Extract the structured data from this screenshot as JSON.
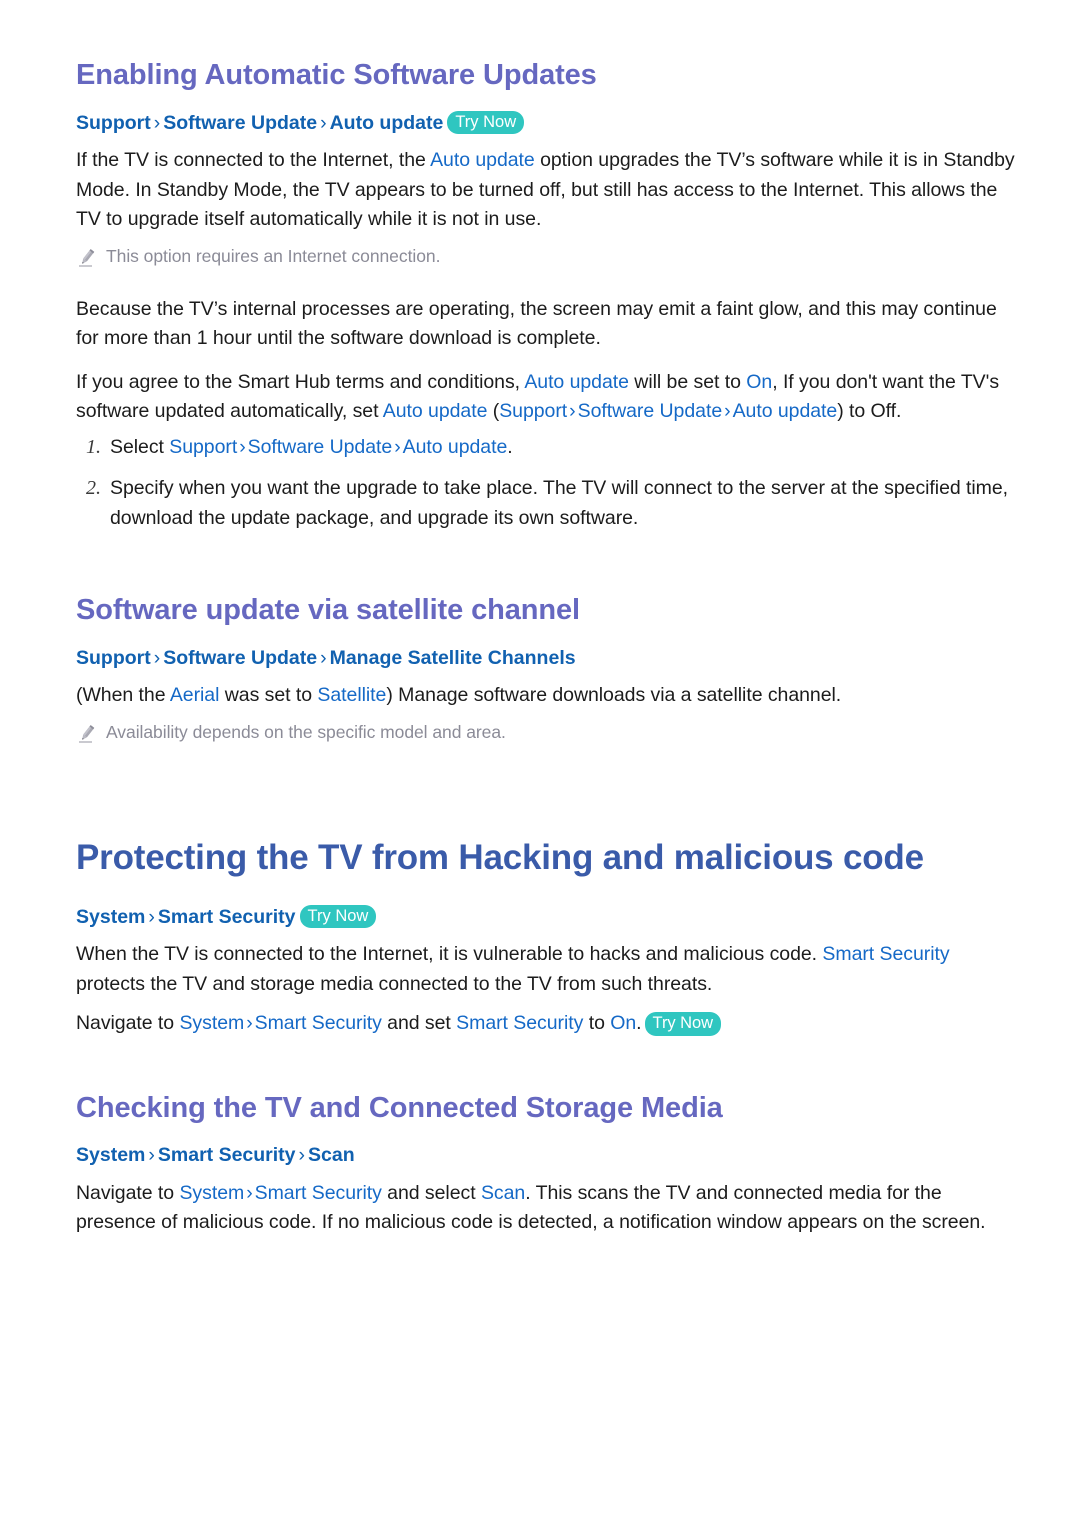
{
  "page": {
    "background": "#ffffff",
    "heading_section_color": "#6668c0",
    "heading_chapter_color": "#3a5ba9",
    "link_color": "#1569c7",
    "breadcrumb_color": "#1161b0",
    "badge_color": "#2fc6c0",
    "note_color": "#8b8b97",
    "body_color": "#1c1c1c"
  },
  "badges": {
    "try_now": "Try Now"
  },
  "icons": {
    "pencil": "pencil-icon",
    "chevron": "›"
  },
  "sections": [
    {
      "id": "enabling-automatic-software-updates",
      "title": "Enabling Automatic Software Updates",
      "breadcrumb": {
        "crumbs": [
          "Support",
          "Software Update",
          "Auto update"
        ],
        "separator": "›",
        "badge": "Try Now"
      },
      "paragraph_1": {
        "pre": "If the TV is connected to the Internet, the ",
        "link": "Auto update",
        "post": " option upgrades the TV’s software while it is in Standby Mode. In Standby Mode, the TV appears to be turned off, but still has access to the Internet. This allows the TV to upgrade itself automatically while it is not in use."
      },
      "note_1": "This option requires an Internet connection.",
      "paragraph_2": "Because the TV’s internal processes are operating, the screen may emit a faint glow, and this may continue for more than 1 hour until the software download is complete.",
      "paragraph_3": {
        "t1": "If you agree to the Smart Hub terms and conditions, ",
        "l1": "Auto update",
        "t2": " will be set to ",
        "l2": "On",
        "t3": ", If you don't want the TV's software updated automatically, set ",
        "l3": "Auto update",
        "t4": " (",
        "l4": "Support",
        "sep1": "›",
        "l5": "Software Update",
        "sep2": "›",
        "l6": "Auto update",
        "t5": ") to Off."
      },
      "steps": [
        {
          "num": "1.",
          "pre": "Select ",
          "links": [
            "Support",
            "Software Update",
            "Auto update"
          ],
          "separator": "›",
          "post": "."
        },
        {
          "num": "2.",
          "text": "Specify when you want the upgrade to take place. The TV will connect to the server at the specified time, download the update package, and upgrade its own software."
        }
      ]
    },
    {
      "id": "software-update-via-satellite-channel",
      "title": "Software update via satellite channel",
      "breadcrumb": {
        "crumbs": [
          "Support",
          "Software Update",
          "Manage Satellite Channels"
        ],
        "separator": "›"
      },
      "paragraph_1": {
        "t1": "(When the ",
        "l1": "Aerial",
        "t2": " was set to ",
        "l2": "Satellite",
        "t3": ") Manage software downloads via a satellite channel."
      },
      "note_1": "Availability depends on the specific model and area."
    },
    {
      "id": "protecting-the-tv-from-hacking-and-malicious-code",
      "is_chapter": true,
      "title": "Protecting the TV from Hacking and malicious code",
      "breadcrumb": {
        "crumbs": [
          "System",
          "Smart Security"
        ],
        "separator": "›",
        "badge": "Try Now"
      },
      "paragraph_1": {
        "t1": "When the TV is connected to the Internet, it is vulnerable to hacks and malicious code. ",
        "l1": "Smart Security",
        "t2": " protects the TV and storage media connected to the TV from such threats."
      },
      "paragraph_2": {
        "t1": "Navigate to ",
        "l1": "System",
        "sep": "›",
        "l2": "Smart Security",
        "t2": " and set ",
        "l3": "Smart Security",
        "t3": " to ",
        "l4": "On",
        "t4": ".",
        "badge": "Try Now"
      }
    },
    {
      "id": "checking-the-tv-and-connected-storage-media",
      "title": "Checking the TV and Connected Storage Media",
      "breadcrumb": {
        "crumbs": [
          "System",
          "Smart Security",
          "Scan"
        ],
        "separator": "›"
      },
      "paragraph_1": {
        "t1": "Navigate to ",
        "l1": "System",
        "sep": "›",
        "l2": "Smart Security",
        "t2": " and select ",
        "l3": "Scan",
        "t3": ". This scans the TV and connected media for the presence of malicious code. If no malicious code is detected, a notification window appears on the screen."
      }
    }
  ]
}
